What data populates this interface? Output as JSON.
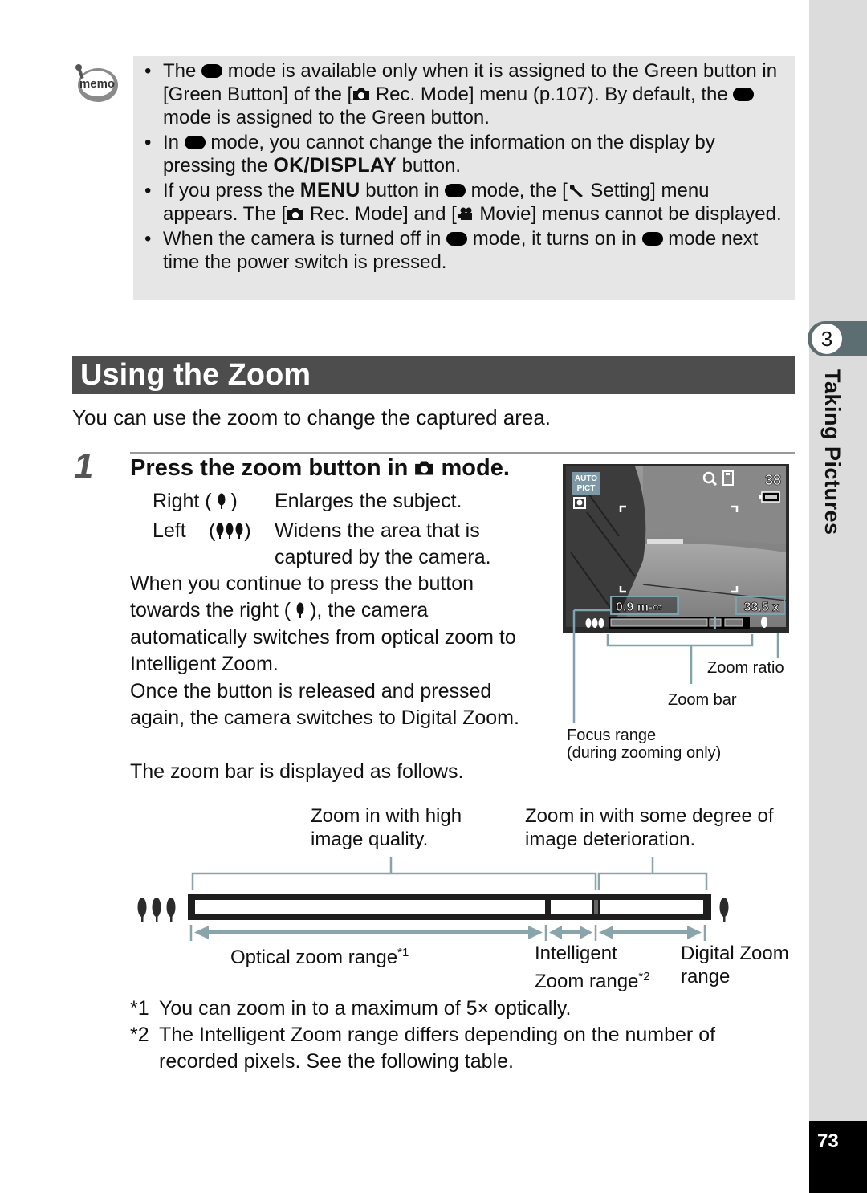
{
  "memo": {
    "icon_label": "memo",
    "items": [
      {
        "parts": [
          "The ",
          "{pill}",
          " mode is available only when it is assigned to the Green button in [Green Button] of the [",
          "{camera}",
          " Rec. Mode] menu (p.107). By default, the ",
          "{pill}",
          " mode is assigned to the Green button."
        ]
      },
      {
        "parts": [
          "In ",
          "{pill}",
          " mode, you cannot change the information on the display by pressing the ",
          "{btn:OK/DISPLAY}",
          " button."
        ]
      },
      {
        "parts": [
          "If you press the ",
          "{btn:MENU}",
          " button in ",
          "{pill}",
          " mode, the [",
          "{wrench}",
          " Setting] menu appears. The [",
          "{camera}",
          " Rec. Mode] and [",
          "{movie}",
          " Movie] menus cannot be displayed."
        ]
      },
      {
        "parts": [
          "When the camera is turned off in ",
          "{pill}",
          " mode, it turns on in ",
          "{pill}",
          " mode next time the power switch is pressed."
        ]
      }
    ]
  },
  "section": {
    "title": "Using the Zoom",
    "intro": "You can use the zoom to change the captured area."
  },
  "step": {
    "number": "1",
    "title_before": "Press the zoom button in ",
    "title_after": " mode.",
    "right_label": "Right (",
    "right_close": ")",
    "right_desc": "Enlarges the subject.",
    "left_label": "Left",
    "left_open": "(",
    "left_close": ")",
    "left_desc_1": "Widens the area that is",
    "left_desc_2": "captured by the camera.",
    "para1_line1": "When you continue to press the button",
    "para1_line2a": "towards the right (",
    "para1_line2b": "), the camera",
    "para1_line3": "automatically switches from optical zoom to",
    "para1_line4": "Intelligent Zoom.",
    "para2_line1": "Once the button is released and pressed",
    "para2_line2": "again, the camera switches to Digital Zoom.",
    "para3": "The zoom bar is displayed as follows."
  },
  "lcd": {
    "mode_badge_1": "AUTO",
    "mode_badge_2": "PICT",
    "shots_remaining": "38",
    "focus_range": "0.9 m-∞",
    "zoom_ratio": "33.5 x",
    "zoom_level": 0.78,
    "callouts": {
      "zoom_ratio": "Zoom ratio",
      "zoom_bar": "Zoom bar",
      "focus_range_1": "Focus range",
      "focus_range_2": "(during zooming only)"
    }
  },
  "zoom_diagram": {
    "top_left_1": "Zoom in with high",
    "top_left_2": "image quality.",
    "top_right_1": "Zoom in with some degree of",
    "top_right_2": "image deterioration.",
    "optical_label": "Optical zoom range",
    "optical_mark": "*1",
    "intelligent_1": "Intelligent",
    "intelligent_2": "Zoom range",
    "intelligent_mark": "*2",
    "digital_1": "Digital Zoom",
    "digital_2": "range"
  },
  "footnotes": [
    {
      "mark": "*1",
      "text": "You can zoom in to a maximum of 5× optically."
    },
    {
      "mark": "*2",
      "text": "The Intelligent Zoom range differs depending on the number of recorded pixels. See the following table."
    }
  ],
  "sidebar": {
    "chapter_number": "3",
    "chapter_title": "Taking Pictures"
  },
  "page_number": "73"
}
